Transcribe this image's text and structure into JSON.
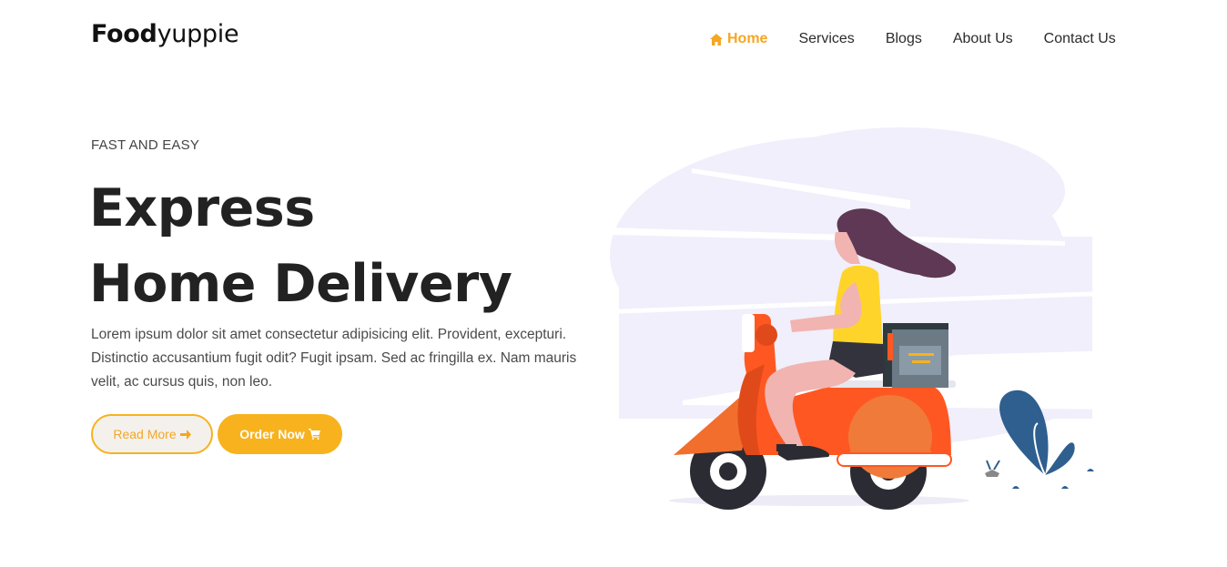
{
  "brand": {
    "bold": "Food",
    "light": "yuppie"
  },
  "nav": [
    {
      "label": "Home",
      "active": true
    },
    {
      "label": "Services",
      "active": false
    },
    {
      "label": "Blogs",
      "active": false
    },
    {
      "label": "About Us",
      "active": false
    },
    {
      "label": "Contact Us",
      "active": false
    }
  ],
  "hero": {
    "eyebrow": "FAST AND EASY",
    "title_line1": "Express",
    "title_line2": "Home Delivery",
    "description": "Lorem ipsum dolor sit amet consectetur adipisicing elit. Provident, excepturi. Distinctio accusantium fugit odit? Fugit ipsam. Sed ac fringilla ex. Nam mauris velit, ac cursus quis, non leo.",
    "read_more": "Read More",
    "order_now": "Order Now"
  },
  "colors": {
    "accent": "#f7b21e",
    "scooter": "#ff5722",
    "blob": "#f0effb",
    "plant": "#2f5f8f"
  },
  "icons": {
    "home": "home-icon",
    "arrow": "arrow-right-icon",
    "cart": "cart-icon"
  }
}
